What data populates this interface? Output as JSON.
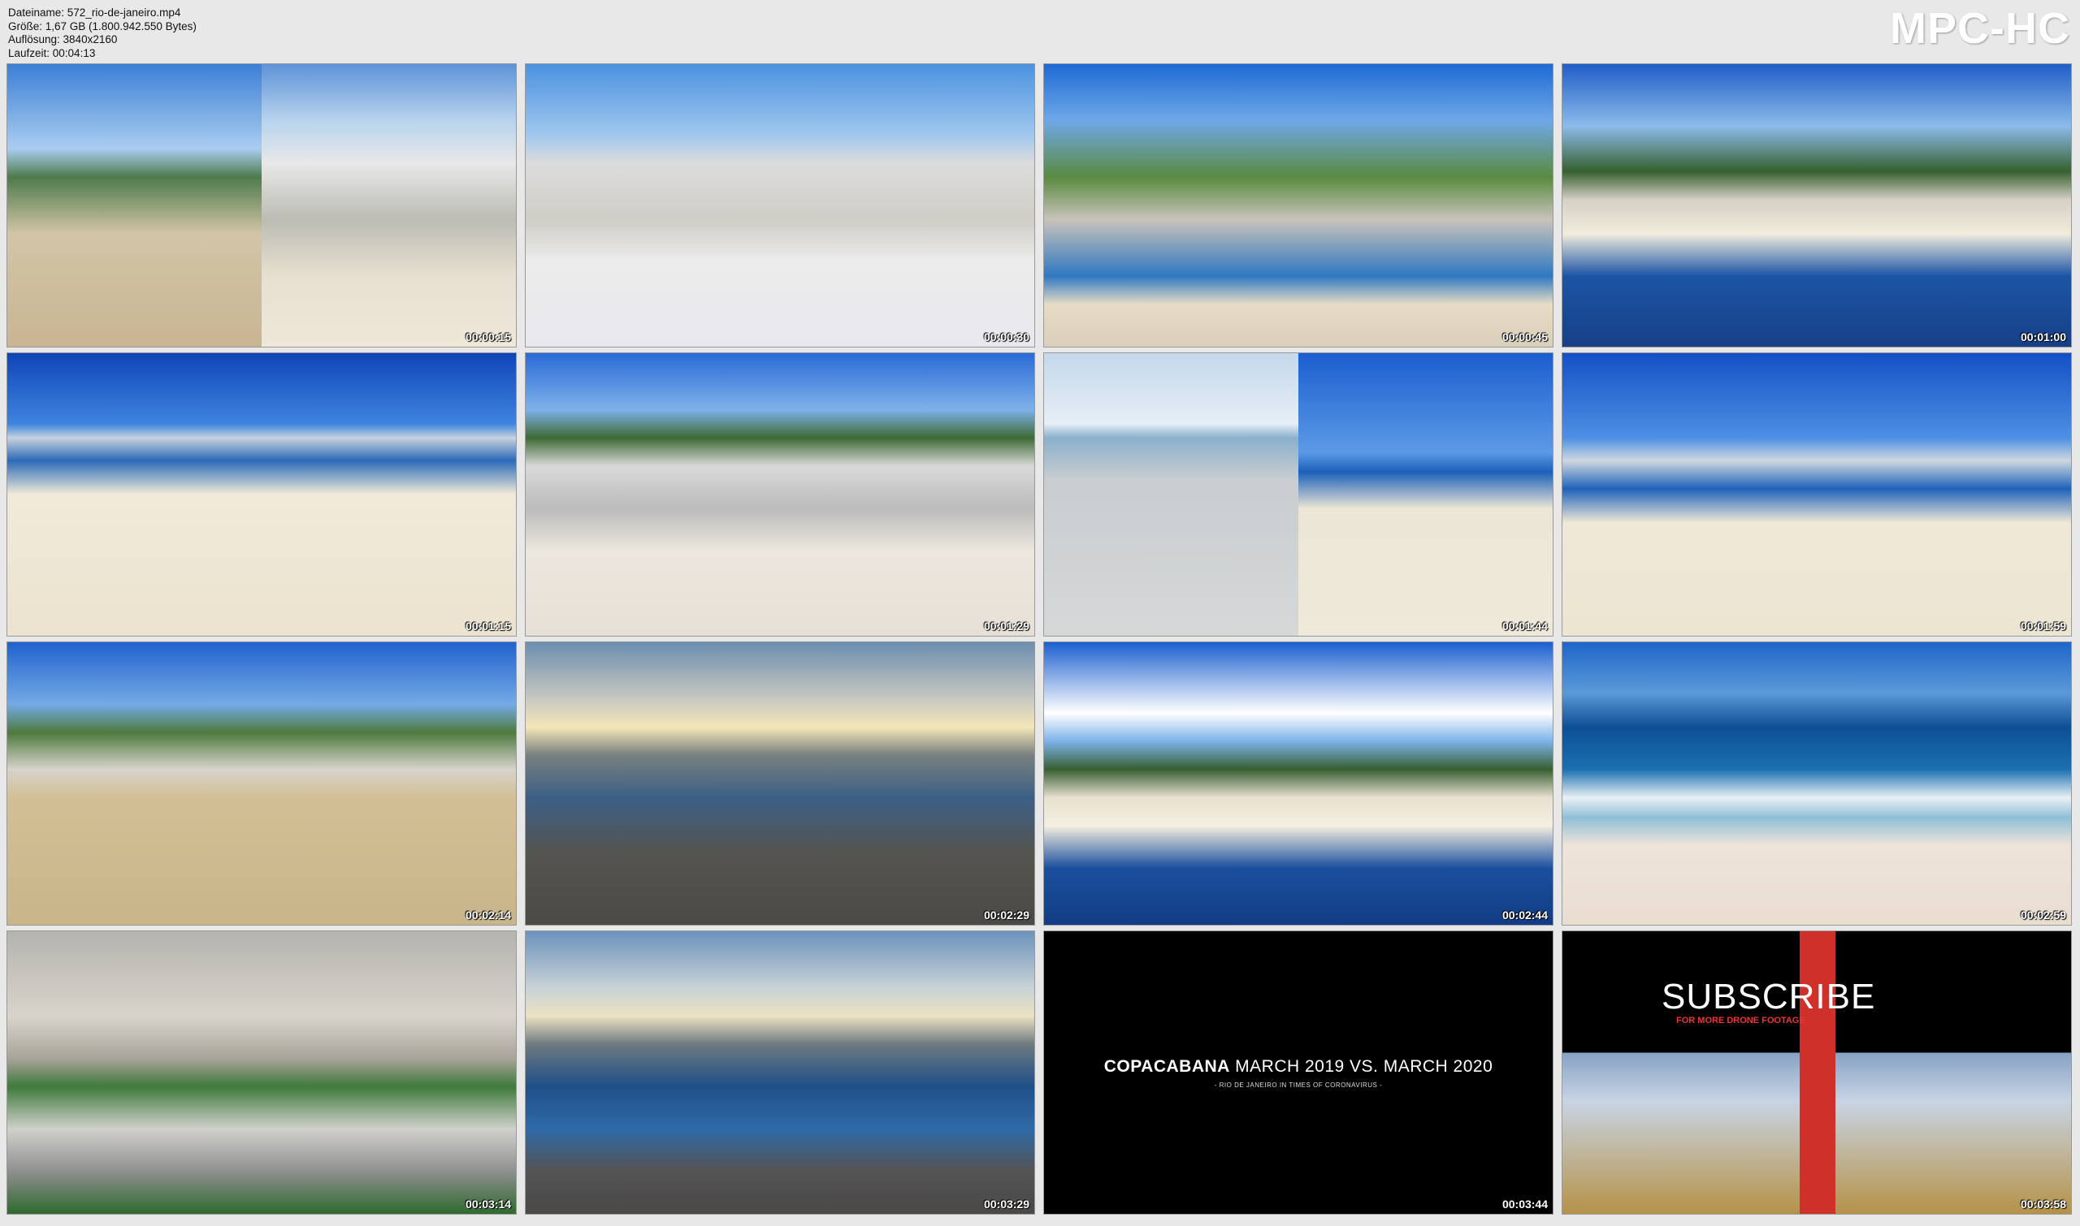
{
  "meta": {
    "filename": "Dateiname: 572_rio-de-janeiro.mp4",
    "size": "Größe: 1,67 GB (1.800.942.550 Bytes)",
    "resolution": "Auflösung: 3840x2160",
    "duration": "Laufzeit: 00:04:13"
  },
  "brand": "MPC-HC",
  "thumbnails": [
    {
      "time": "00:00:15"
    },
    {
      "time": "00:00:30"
    },
    {
      "time": "00:00:45"
    },
    {
      "time": "00:01:00"
    },
    {
      "time": "00:01:15"
    },
    {
      "time": "00:01:29"
    },
    {
      "time": "00:01:44"
    },
    {
      "time": "00:01:59"
    },
    {
      "time": "00:02:14"
    },
    {
      "time": "00:02:29"
    },
    {
      "time": "00:02:44"
    },
    {
      "time": "00:02:59"
    },
    {
      "time": "00:03:14"
    },
    {
      "time": "00:03:29"
    },
    {
      "time": "00:03:44"
    },
    {
      "time": "00:03:58"
    }
  ],
  "title_card": {
    "bold": "COPACABANA",
    "rest": " MARCH 2019 VS. MARCH 2020",
    "sub": "- RIO DE JANEIRO IN TIMES OF CORONAVIRUS -"
  },
  "subscribe_card": {
    "word": "SUBSCRIBE",
    "tagline": "FOR MORE DRONE FOOTAGE"
  },
  "colors": {
    "background": "#e8e8e8",
    "timestamp": "#ffffff",
    "subscribe_red": "#d0302a"
  }
}
